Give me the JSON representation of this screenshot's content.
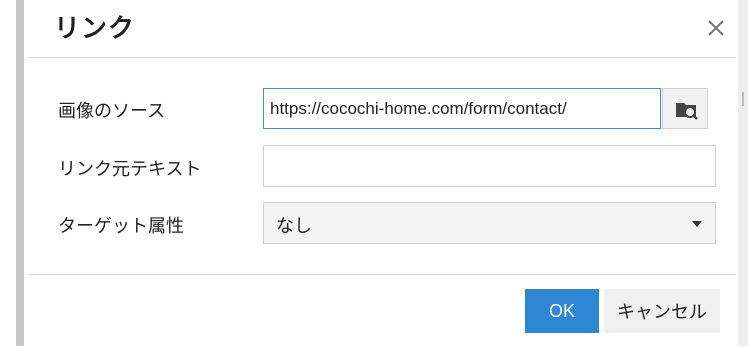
{
  "dialog": {
    "title": "リンク",
    "close_icon": "close-icon"
  },
  "form": {
    "source_label": "画像のソース",
    "source_value": "https://cocochi-home.com/form/contact/",
    "browse_icon": "browse-image-icon",
    "link_text_label": "リンク元テキスト",
    "link_text_value": "",
    "target_label": "ターゲット属性",
    "target_selected": "なし"
  },
  "footer": {
    "ok_label": "OK",
    "cancel_label": "キャンセル"
  },
  "colors": {
    "primary": "#2e87d2",
    "focus_border": "#3a8fd9"
  }
}
